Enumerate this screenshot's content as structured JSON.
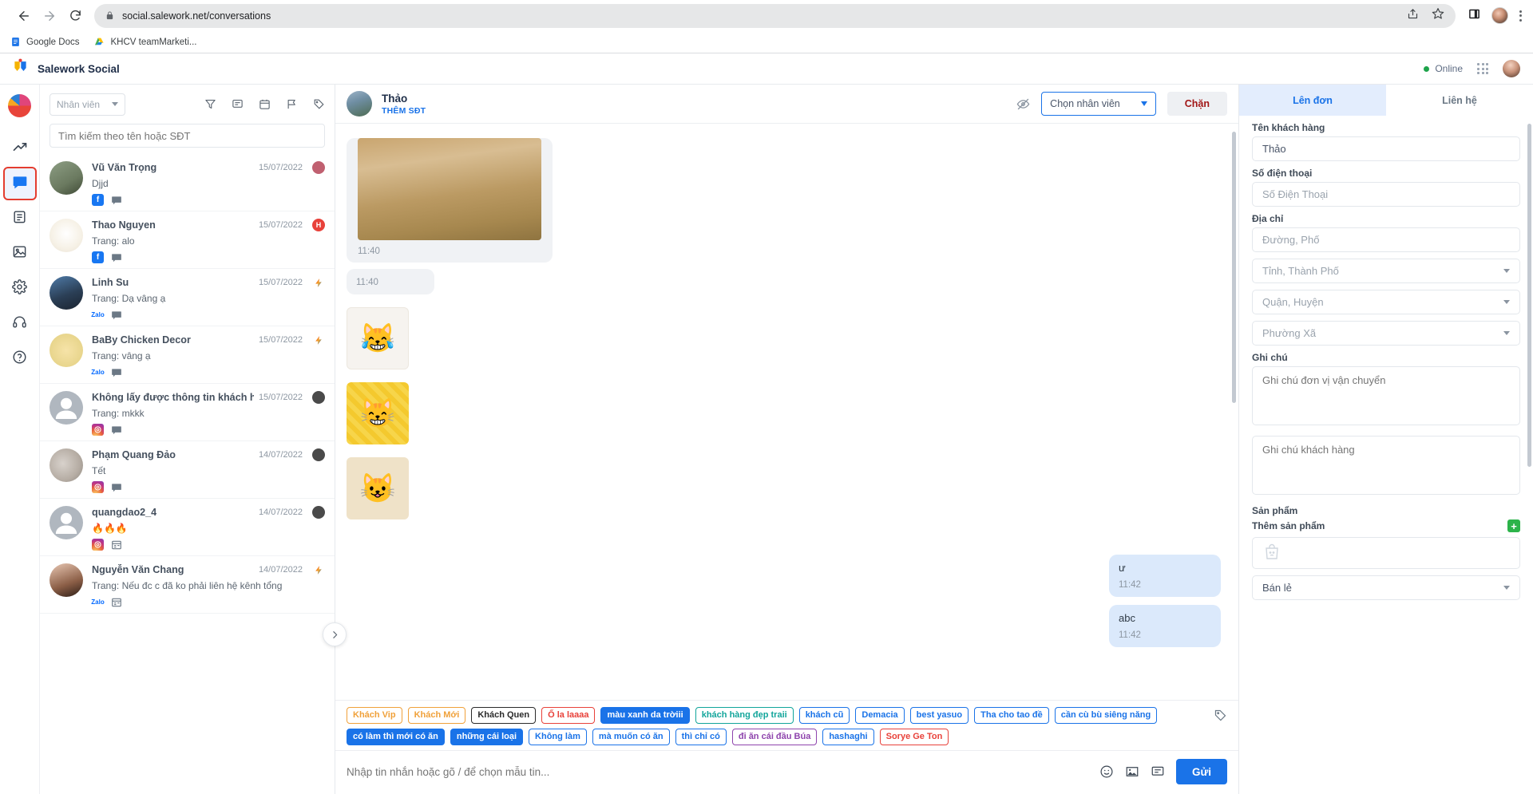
{
  "browser": {
    "url": "social.salework.net/conversations",
    "back_icon": "back-arrow-icon",
    "forward_icon": "forward-arrow-icon",
    "reload_icon": "reload-icon",
    "lock_icon": "lock-icon",
    "share_icon": "share-icon",
    "bookmark_icon": "star-icon",
    "sidepanel_icon": "side-panel-icon",
    "menu_icon": "kebab-menu-icon",
    "bookmarks": [
      {
        "label": "Google Docs",
        "icon": "google-docs-icon"
      },
      {
        "label": "KHCV teamMarketi...",
        "icon": "google-drive-icon"
      }
    ]
  },
  "app_header": {
    "brand": "Salework Social",
    "status": "Online",
    "apps_icon": "grid-apps-icon",
    "avatar_icon": "user-avatar"
  },
  "rail": {
    "items": [
      {
        "name": "analytics",
        "icon": "trending-up-icon"
      },
      {
        "name": "conversations",
        "icon": "chat-bubble-icon",
        "active": true
      },
      {
        "name": "orders",
        "icon": "clipboard-list-icon"
      },
      {
        "name": "media",
        "icon": "image-icon"
      },
      {
        "name": "settings",
        "icon": "gear-icon"
      },
      {
        "name": "support",
        "icon": "headset-icon"
      },
      {
        "name": "help",
        "icon": "question-circle-icon"
      }
    ]
  },
  "conversation_list": {
    "staff_filter": "Nhân viên",
    "toolbar_icons": [
      "filter-icon",
      "comment-icon",
      "calendar-icon",
      "flag-icon",
      "tag-icon"
    ],
    "search_placeholder": "Tìm kiếm theo tên hoặc SĐT",
    "expand_icon": "chevron-right-icon",
    "items": [
      {
        "name": "Vũ Văn Trọng",
        "snippet": "Djjd",
        "date": "15/07/2022",
        "channel": "facebook",
        "second_icon": "message-icon",
        "badge": "#c06070"
      },
      {
        "name": "Thao Nguyen",
        "snippet": "Trang: alo",
        "date": "15/07/2022",
        "channel": "facebook",
        "second_icon": "message-icon",
        "badge": "#e8413a",
        "badge_letter": "H"
      },
      {
        "name": "Linh Su",
        "snippet": "Trang: Dạ vâng ạ",
        "date": "15/07/2022",
        "channel": "zalo",
        "second_icon": "message-icon",
        "badge": "flash"
      },
      {
        "name": "BaBy Chicken Decor",
        "snippet": "Trang: vâng ạ",
        "date": "15/07/2022",
        "channel": "zalo",
        "second_icon": "message-icon",
        "badge": "flash"
      },
      {
        "name": "Không lấy được thông tin khách hàng",
        "snippet": "Trang: mkkk",
        "date": "15/07/2022",
        "channel": "instagram",
        "second_icon": "message-icon",
        "badge": "#4a4a4a"
      },
      {
        "name": "Phạm Quang Đảo",
        "snippet": "Tết",
        "date": "14/07/2022",
        "channel": "instagram",
        "second_icon": "message-icon",
        "badge": "#4a4a4a"
      },
      {
        "name": "quangdao2_4",
        "snippet": "🔥🔥🔥",
        "date": "14/07/2022",
        "channel": "instagram",
        "second_icon": "news-icon",
        "badge": "#4a4a4a"
      },
      {
        "name": "Nguyễn Văn Chang",
        "snippet": "Trang: Nếu đc c đã ko phải liên hệ kênh tổng",
        "date": "14/07/2022",
        "channel": "zalo",
        "second_icon": "news-icon",
        "badge": "flash"
      }
    ]
  },
  "chat": {
    "title": "Thảo",
    "add_phone_label": "THÊM SĐT",
    "eye_icon": "eye-off-icon",
    "staff_select": "Chọn nhân viên",
    "block_button": "Chặn",
    "messages": [
      {
        "type": "image",
        "side": "in",
        "time": "11:40"
      },
      {
        "type": "text",
        "side": "in",
        "text": "",
        "time": "11:40"
      },
      {
        "type": "sticker",
        "side": "in",
        "glyph": "😹",
        "style": "st1"
      },
      {
        "type": "sticker",
        "side": "in",
        "glyph": "😸",
        "style": "st2"
      },
      {
        "type": "sticker",
        "side": "in",
        "glyph": "😺",
        "style": "st3"
      },
      {
        "type": "text",
        "side": "out",
        "text": "ư",
        "time": "11:42"
      },
      {
        "type": "text",
        "side": "out",
        "text": "abc",
        "time": "11:42"
      }
    ],
    "tags": [
      {
        "label": "Khách Vip",
        "color": "#f0a13a",
        "solid": false
      },
      {
        "label": "Khách Mới",
        "color": "#f0a13a",
        "solid": false
      },
      {
        "label": "Khách Quen",
        "color": "#2b2b2b",
        "solid": false
      },
      {
        "label": "Ố la laaaa",
        "color": "#e8413a",
        "solid": false
      },
      {
        "label": "màu xanh da trờiii",
        "color": "#1a73e8",
        "solid": true
      },
      {
        "label": "khách hàng đẹp traii",
        "color": "#12a59b",
        "solid": false
      },
      {
        "label": "khách cũ",
        "color": "#1a73e8",
        "solid": false
      },
      {
        "label": "Demacia",
        "color": "#1a73e8",
        "solid": false
      },
      {
        "label": "best yasuo",
        "color": "#1a73e8",
        "solid": false
      },
      {
        "label": "Tha cho tao đề",
        "color": "#1a73e8",
        "solid": false
      },
      {
        "label": "cần cù bù siêng năng",
        "color": "#1a73e8",
        "solid": false
      },
      {
        "label": "có làm thì mới có ăn",
        "color": "#1a73e8",
        "solid": true
      },
      {
        "label": "những cái loại",
        "color": "#1a73e8",
        "solid": true
      },
      {
        "label": "Không làm",
        "color": "#1a73e8",
        "solid": false
      },
      {
        "label": "mà muốn có ăn",
        "color": "#1a73e8",
        "solid": false
      },
      {
        "label": "thì chỉ có",
        "color": "#1a73e8",
        "solid": false
      },
      {
        "label": "đi ăn cái đầu Búa",
        "color": "#8e44ad",
        "solid": false
      },
      {
        "label": "hashaghi",
        "color": "#1a73e8",
        "solid": false
      },
      {
        "label": "Sorye Ge Ton",
        "color": "#e8413a",
        "solid": false
      }
    ],
    "tag_edit_icon": "tag-edit-icon",
    "composer_placeholder": "Nhập tin nhắn hoặc gõ / để chọn mẫu tin...",
    "composer_icons": [
      "emoji-icon",
      "image-icon",
      "quick-reply-icon"
    ],
    "send_button": "Gửi"
  },
  "right_panel": {
    "tabs": [
      {
        "label": "Lên đơn",
        "active": true
      },
      {
        "label": "Liên hệ",
        "active": false
      }
    ],
    "fields": {
      "customer_name_label": "Tên khách hàng",
      "customer_name_value": "Thảo",
      "phone_label": "Số điện thoại",
      "phone_placeholder": "Số Điện Thoại",
      "address_label": "Địa chỉ",
      "street_placeholder": "Đường, Phố",
      "province_placeholder": "Tỉnh, Thành Phố",
      "district_placeholder": "Quận, Huyện",
      "ward_placeholder": "Phường Xã",
      "note_label": "Ghi chú",
      "shipping_note_placeholder": "Ghi chú đơn vị vận chuyển",
      "customer_note_placeholder": "Ghi chú khách hàng",
      "product_label": "Sản phẩm",
      "add_product_label": "Thêm sản phẩm",
      "add_product_icon": "plus-icon",
      "empty_product_icon": "empty-bag-icon",
      "channel_value": "Bán lẻ"
    }
  }
}
